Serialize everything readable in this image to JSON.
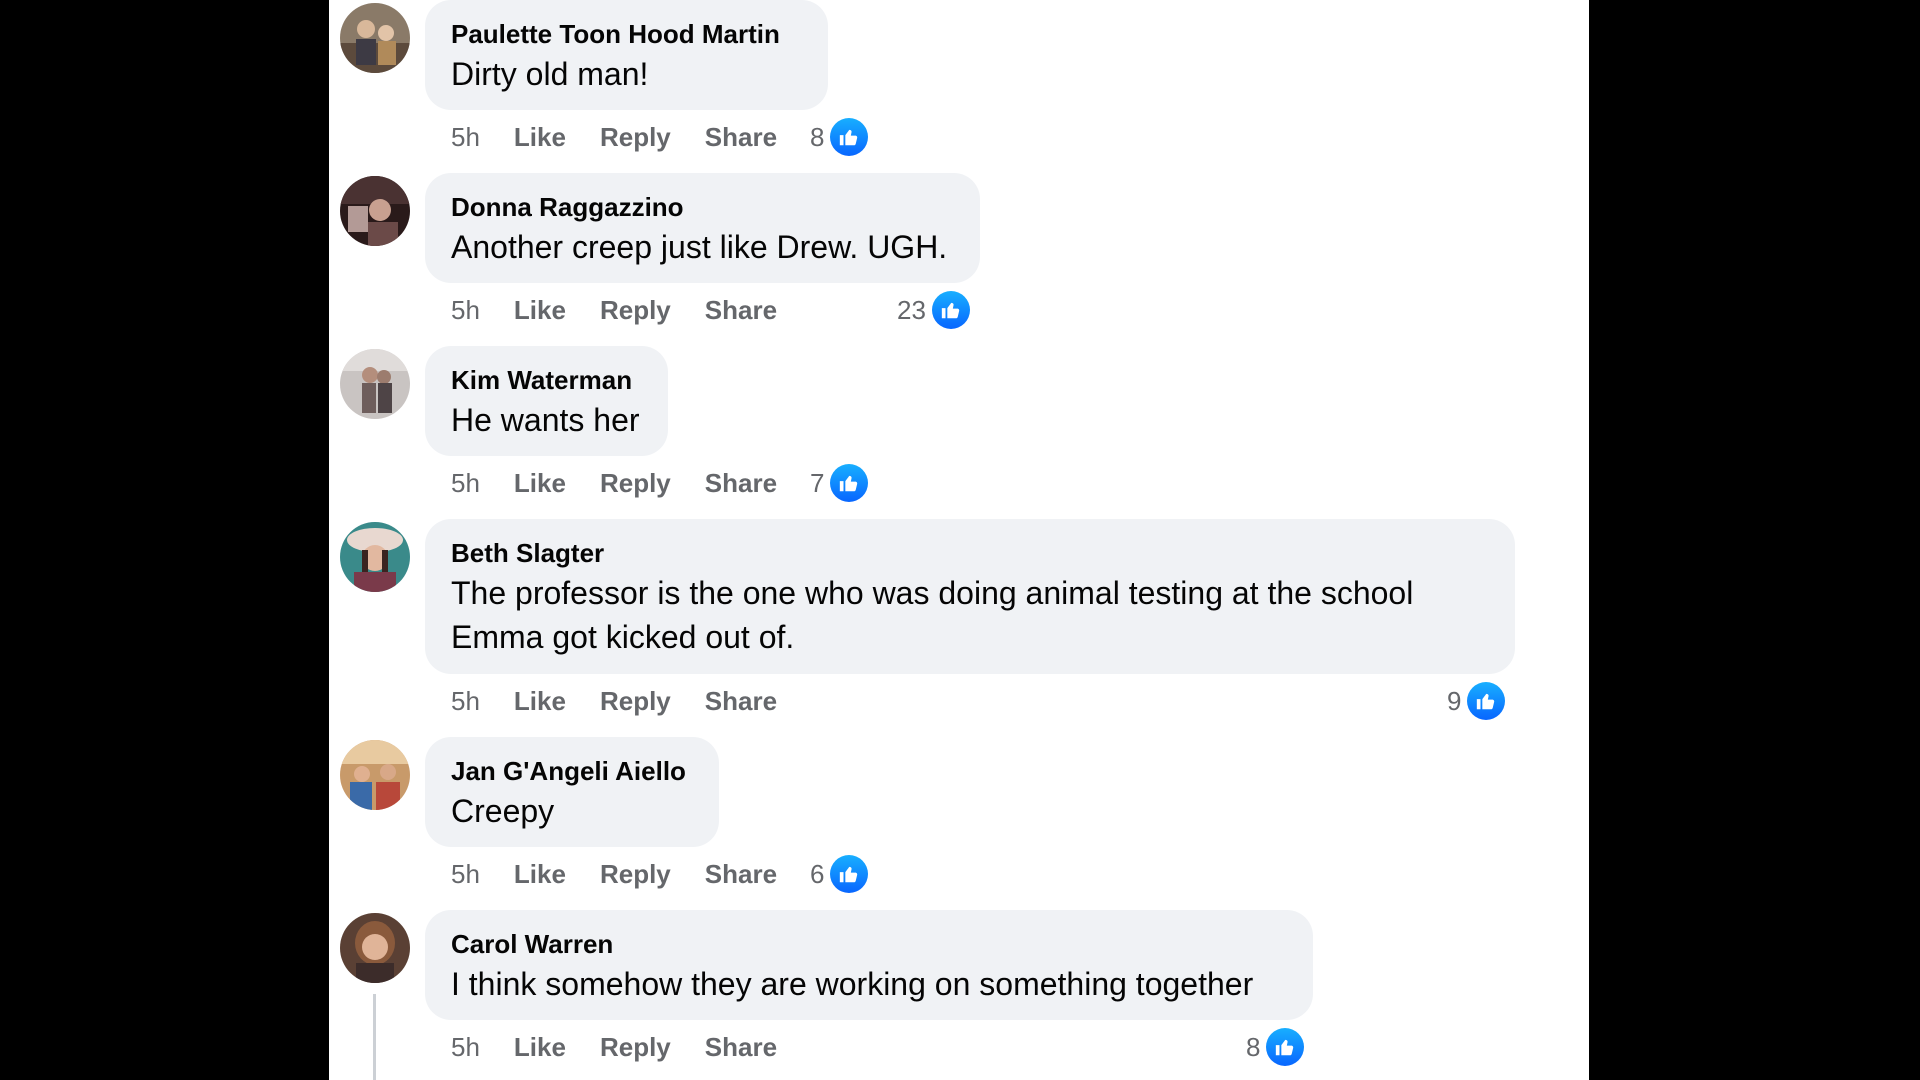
{
  "colors": {
    "background": "#000000",
    "panel": "#ffffff",
    "bubble": "#f0f2f5",
    "text": "#050505",
    "secondary_text": "#65676b",
    "like_blue": "#0866ff"
  },
  "comments": [
    {
      "author": "Paulette Toon Hood Martin",
      "text": "Dirty old man!",
      "time": "5h",
      "like_label": "Like",
      "reply_label": "Reply",
      "share_label": "Share",
      "reaction_count": "8",
      "reaction_icon": "thumbs-up-icon"
    },
    {
      "author": "Donna Raggazzino",
      "text": "Another creep just like Drew. UGH.",
      "time": "5h",
      "like_label": "Like",
      "reply_label": "Reply",
      "share_label": "Share",
      "reaction_count": "23",
      "reaction_icon": "thumbs-up-icon"
    },
    {
      "author": "Kim Waterman",
      "text": "He wants her",
      "time": "5h",
      "like_label": "Like",
      "reply_label": "Reply",
      "share_label": "Share",
      "reaction_count": "7",
      "reaction_icon": "thumbs-up-icon"
    },
    {
      "author": "Beth Slagter",
      "text": "The professor is the one who was doing animal testing at the school Emma got kicked out of.",
      "time": "5h",
      "like_label": "Like",
      "reply_label": "Reply",
      "share_label": "Share",
      "reaction_count": "9",
      "reaction_icon": "thumbs-up-icon"
    },
    {
      "author": "Jan G'Angeli Aiello",
      "text": "Creepy",
      "time": "5h",
      "like_label": "Like",
      "reply_label": "Reply",
      "share_label": "Share",
      "reaction_count": "6",
      "reaction_icon": "thumbs-up-icon"
    },
    {
      "author": "Carol Warren",
      "text": "I think somehow they are working on something together",
      "time": "5h",
      "like_label": "Like",
      "reply_label": "Reply",
      "share_label": "Share",
      "reaction_count": "8",
      "reaction_icon": "thumbs-up-icon"
    }
  ]
}
